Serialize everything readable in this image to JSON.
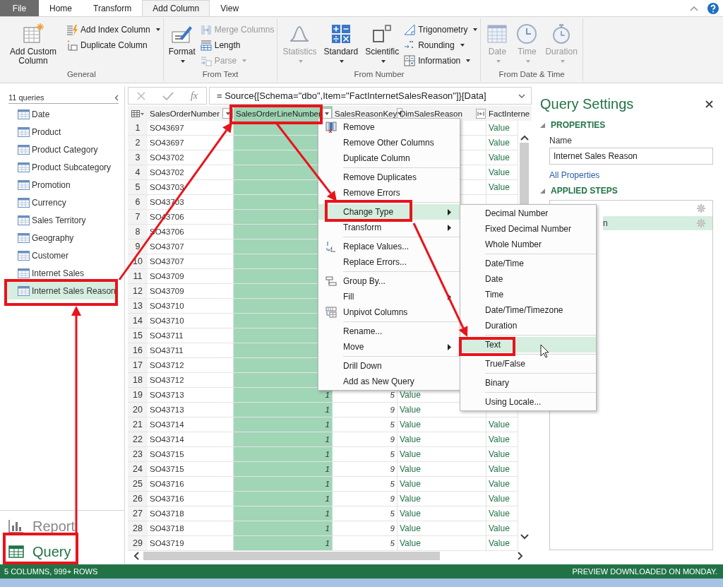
{
  "ribbon": {
    "file_tab": "File",
    "tabs": [
      {
        "label": "Home",
        "selected": false
      },
      {
        "label": "Transform",
        "selected": false
      },
      {
        "label": "Add Column",
        "selected": true
      },
      {
        "label": "View",
        "selected": false
      }
    ],
    "groups": [
      {
        "label": "General",
        "large": [
          {
            "label": "Add Custom Column",
            "kind": "custom-column",
            "dropdown": false,
            "disabled": false
          }
        ],
        "small": [
          {
            "label": "Add Index Column",
            "kind": "index",
            "dropdown": true,
            "disabled": false
          },
          {
            "label": "Duplicate Column",
            "kind": "duplicate",
            "dropdown": false,
            "disabled": false
          }
        ]
      },
      {
        "label": "From Text",
        "large": [
          {
            "label": "Format",
            "kind": "format",
            "dropdown": true,
            "disabled": false
          }
        ],
        "small": [
          {
            "label": "Merge Columns",
            "kind": "merge",
            "dropdown": false,
            "disabled": true
          },
          {
            "label": "Length",
            "kind": "length",
            "dropdown": false,
            "disabled": false
          },
          {
            "label": "Parse",
            "kind": "parse",
            "dropdown": true,
            "disabled": true
          }
        ]
      },
      {
        "label": "From Number",
        "large": [
          {
            "label": "Statistics",
            "kind": "statistics",
            "dropdown": true,
            "disabled": true
          },
          {
            "label": "Standard",
            "kind": "standard",
            "dropdown": true,
            "disabled": false
          },
          {
            "label": "Scientific",
            "kind": "scientific",
            "dropdown": true,
            "disabled": false
          }
        ],
        "small": [
          {
            "label": "Trigonometry",
            "kind": "trigonometry",
            "dropdown": true,
            "disabled": false
          },
          {
            "label": "Rounding",
            "kind": "rounding",
            "dropdown": true,
            "disabled": false
          },
          {
            "label": "Information",
            "kind": "information",
            "dropdown": true,
            "disabled": false
          }
        ]
      },
      {
        "label": "From Date & Time",
        "large": [
          {
            "label": "Date",
            "kind": "date",
            "dropdown": true,
            "disabled": true
          },
          {
            "label": "Time",
            "kind": "time",
            "dropdown": true,
            "disabled": true
          },
          {
            "label": "Duration",
            "kind": "duration",
            "dropdown": true,
            "disabled": true
          }
        ]
      }
    ]
  },
  "queries": {
    "count_label": "11 queries",
    "items": [
      {
        "label": "Date",
        "selected": false
      },
      {
        "label": "Product",
        "selected": false
      },
      {
        "label": "Product Category",
        "selected": false
      },
      {
        "label": "Product Subcategory",
        "selected": false
      },
      {
        "label": "Promotion",
        "selected": false
      },
      {
        "label": "Currency",
        "selected": false
      },
      {
        "label": "Sales Territory",
        "selected": false
      },
      {
        "label": "Geography",
        "selected": false
      },
      {
        "label": "Customer",
        "selected": false
      },
      {
        "label": "Internet Sales",
        "selected": false
      },
      {
        "label": "Internet Sales Reason",
        "selected": true
      }
    ]
  },
  "nav": [
    {
      "label": "Report",
      "kind": "report",
      "selected": false
    },
    {
      "label": "Query",
      "kind": "query",
      "selected": true
    }
  ],
  "formula": {
    "function_label": "fx",
    "text": "= Source{[Schema=\"dbo\",Item=\"FactInternetSalesReason\"]}[Data]"
  },
  "table": {
    "columns": [
      {
        "label": "SalesOrderNumber",
        "kind": "filter",
        "selected": false
      },
      {
        "label": "SalesOrderLineNumber",
        "kind": "filter",
        "selected": true
      },
      {
        "label": "SalesReasonKey",
        "kind": "filter",
        "selected": false
      },
      {
        "label": "DimSalesReason",
        "kind": "expand",
        "selected": false
      },
      {
        "label": "FactInterne",
        "selected": false
      }
    ],
    "rows": [
      {
        "n": "1",
        "order": "SO43697",
        "fact": "Value"
      },
      {
        "n": "2",
        "order": "SO43697",
        "fact": "Value"
      },
      {
        "n": "3",
        "order": "SO43702",
        "fact": "Value"
      },
      {
        "n": "4",
        "order": "SO43702",
        "fact": "Value"
      },
      {
        "n": "5",
        "order": "SO43703",
        "fact": "Value"
      },
      {
        "n": "6",
        "order": "SO43703"
      },
      {
        "n": "7",
        "order": "SO43706"
      },
      {
        "n": "8",
        "order": "SO43706"
      },
      {
        "n": "9",
        "order": "SO43707"
      },
      {
        "n": "10",
        "order": "SO43707"
      },
      {
        "n": "11",
        "order": "SO43709"
      },
      {
        "n": "12",
        "order": "SO43709"
      },
      {
        "n": "13",
        "order": "SO43710"
      },
      {
        "n": "14",
        "order": "SO43710"
      },
      {
        "n": "15",
        "order": "SO43711"
      },
      {
        "n": "16",
        "order": "SO43711"
      },
      {
        "n": "17",
        "order": "SO43712"
      },
      {
        "n": "18",
        "order": "SO43712"
      },
      {
        "n": "19",
        "order": "SO43713",
        "line": "1",
        "key": "5",
        "dim": "Value"
      },
      {
        "n": "20",
        "order": "SO43713",
        "line": "1",
        "key": "9",
        "dim": "Value"
      },
      {
        "n": "21",
        "order": "SO43714",
        "line": "1",
        "key": "5",
        "dim": "Value",
        "fact": "Value"
      },
      {
        "n": "22",
        "order": "SO43714",
        "line": "1",
        "key": "9",
        "dim": "Value",
        "fact": "Value"
      },
      {
        "n": "23",
        "order": "SO43715",
        "line": "1",
        "key": "5",
        "dim": "Value",
        "fact": "Value"
      },
      {
        "n": "24",
        "order": "SO43715",
        "line": "1",
        "key": "9",
        "dim": "Value",
        "fact": "Value"
      },
      {
        "n": "25",
        "order": "SO43716",
        "line": "1",
        "key": "5",
        "dim": "Value",
        "fact": "Value"
      },
      {
        "n": "26",
        "order": "SO43716",
        "line": "1",
        "key": "9",
        "dim": "Value",
        "fact": "Value"
      },
      {
        "n": "27",
        "order": "SO43718",
        "line": "1",
        "key": "5",
        "dim": "Value",
        "fact": "Value"
      },
      {
        "n": "28",
        "order": "SO43718",
        "line": "1",
        "key": "9",
        "dim": "Value",
        "fact": "Value"
      },
      {
        "n": "29",
        "order": "SO43719",
        "line": "1",
        "key": "5",
        "dim": "Value",
        "fact": "Value"
      }
    ]
  },
  "context_menu": [
    {
      "kind": "remove",
      "label": "Remove",
      "submenu": false,
      "selected": false
    },
    {
      "kind": "plain",
      "label": "Remove Other Columns",
      "submenu": false,
      "selected": false
    },
    {
      "kind": "plain",
      "label": "Duplicate Column",
      "submenu": false,
      "selected": false
    },
    {
      "kind": "separator"
    },
    {
      "kind": "plain",
      "label": "Remove Duplicates",
      "submenu": false,
      "selected": false
    },
    {
      "kind": "plain",
      "label": "Remove Errors",
      "submenu": false,
      "selected": false
    },
    {
      "kind": "separator"
    },
    {
      "kind": "plain",
      "label": "Change Type",
      "submenu": true,
      "selected": true
    },
    {
      "kind": "plain",
      "label": "Transform",
      "submenu": true,
      "selected": false
    },
    {
      "kind": "separator"
    },
    {
      "kind": "replace",
      "label": "Replace Values...",
      "submenu": false,
      "selected": false
    },
    {
      "kind": "plain",
      "label": "Replace Errors...",
      "submenu": false,
      "selected": false
    },
    {
      "kind": "separator"
    },
    {
      "kind": "group",
      "label": "Group By...",
      "submenu": false,
      "selected": false
    },
    {
      "kind": "plain",
      "label": "Fill",
      "submenu": true,
      "selected": false
    },
    {
      "kind": "unpivot",
      "label": "Unpivot Columns",
      "submenu": false,
      "selected": false
    },
    {
      "kind": "separator"
    },
    {
      "kind": "plain",
      "label": "Rename...",
      "submenu": false,
      "selected": false
    },
    {
      "kind": "plain",
      "label": "Move",
      "submenu": true,
      "selected": false
    },
    {
      "kind": "separator"
    },
    {
      "kind": "plain",
      "label": "Drill Down",
      "submenu": false,
      "selected": false
    },
    {
      "kind": "plain",
      "label": "Add as New Query",
      "submenu": false,
      "selected": false
    }
  ],
  "type_submenu": [
    {
      "kind": "plain",
      "label": "Decimal Number",
      "selected": false
    },
    {
      "kind": "plain",
      "label": "Fixed Decimal Number",
      "selected": false
    },
    {
      "kind": "plain",
      "label": "Whole Number",
      "selected": false
    },
    {
      "kind": "separator"
    },
    {
      "kind": "plain",
      "label": "Date/Time",
      "selected": false
    },
    {
      "kind": "plain",
      "label": "Date",
      "selected": false
    },
    {
      "kind": "plain",
      "label": "Time",
      "selected": false
    },
    {
      "kind": "plain",
      "label": "Date/Time/Timezone",
      "selected": false
    },
    {
      "kind": "plain",
      "label": "Duration",
      "selected": false
    },
    {
      "kind": "separator"
    },
    {
      "kind": "plain",
      "label": "Text",
      "selected": true
    },
    {
      "kind": "separator"
    },
    {
      "kind": "plain",
      "label": "True/False",
      "selected": false
    },
    {
      "kind": "separator"
    },
    {
      "kind": "plain",
      "label": "Binary",
      "selected": false
    },
    {
      "kind": "separator"
    },
    {
      "kind": "plain",
      "label": "Using Locale...",
      "selected": false
    }
  ],
  "settings": {
    "title": "Query Settings",
    "properties_heading": "PROPERTIES",
    "name_label": "Name",
    "name_value": "Internet Sales Reason",
    "all_properties_link": "All Properties",
    "steps_heading": "APPLIED STEPS",
    "steps": [
      {
        "selected": false
      },
      {
        "label": "n",
        "selected": true
      }
    ]
  },
  "status_bar": {
    "left": "5 COLUMNS, 999+ ROWS",
    "right": "PREVIEW DOWNLOADED ON MONDAY."
  }
}
